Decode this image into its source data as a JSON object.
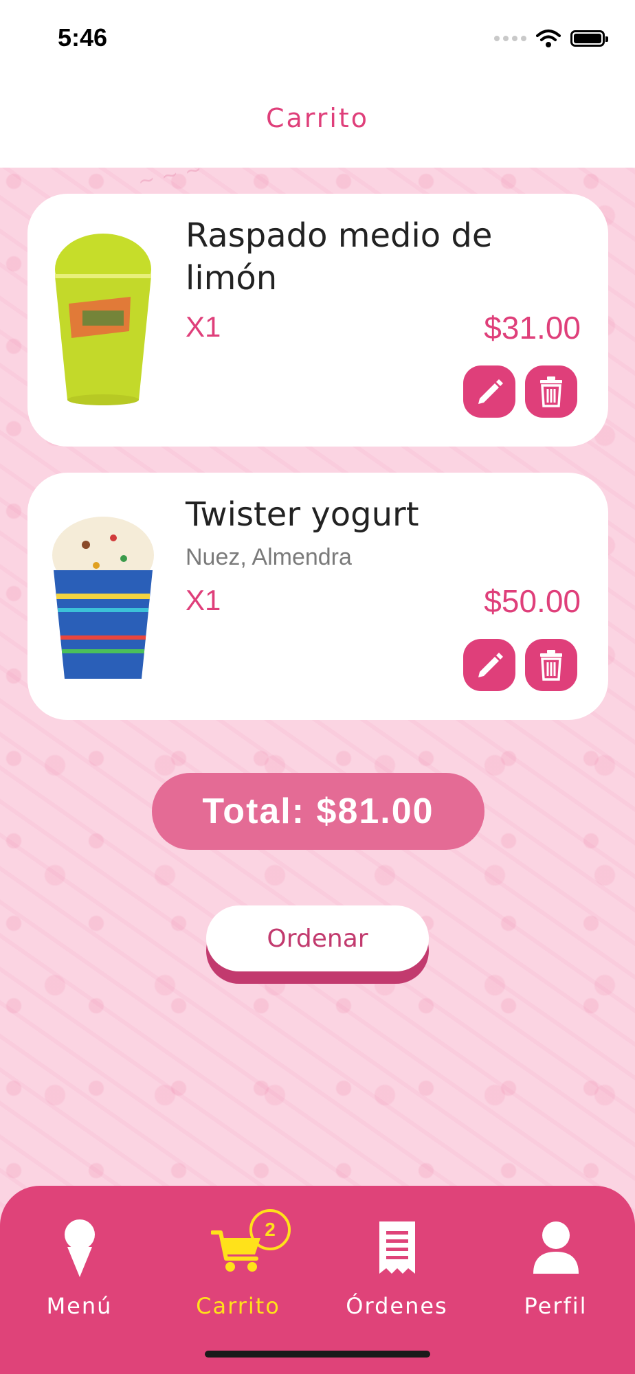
{
  "status_bar": {
    "time": "5:46"
  },
  "header": {
    "title": "Carrito"
  },
  "cart": {
    "items": [
      {
        "name": "Raspado medio de limón",
        "options": "",
        "quantity": "X1",
        "price": "$31.00",
        "image": "lime-raspado-cup"
      },
      {
        "name": "Twister yogurt",
        "options": "Nuez, Almendra",
        "quantity": "X1",
        "price": "$50.00",
        "image": "twister-yogurt-cup"
      }
    ],
    "total_label": "Total: $81.00",
    "order_button": "Ordenar"
  },
  "tabbar": {
    "tabs": [
      {
        "label": "Menú",
        "icon": "ice-cream-icon",
        "active": false
      },
      {
        "label": "Carrito",
        "icon": "cart-icon",
        "active": true,
        "badge": "2"
      },
      {
        "label": "Órdenes",
        "icon": "receipt-icon",
        "active": false
      },
      {
        "label": "Perfil",
        "icon": "user-icon",
        "active": false
      }
    ]
  },
  "colors": {
    "accent": "#df3f7a",
    "active_tab": "#ffe21a",
    "background": "#fbd4e2"
  }
}
